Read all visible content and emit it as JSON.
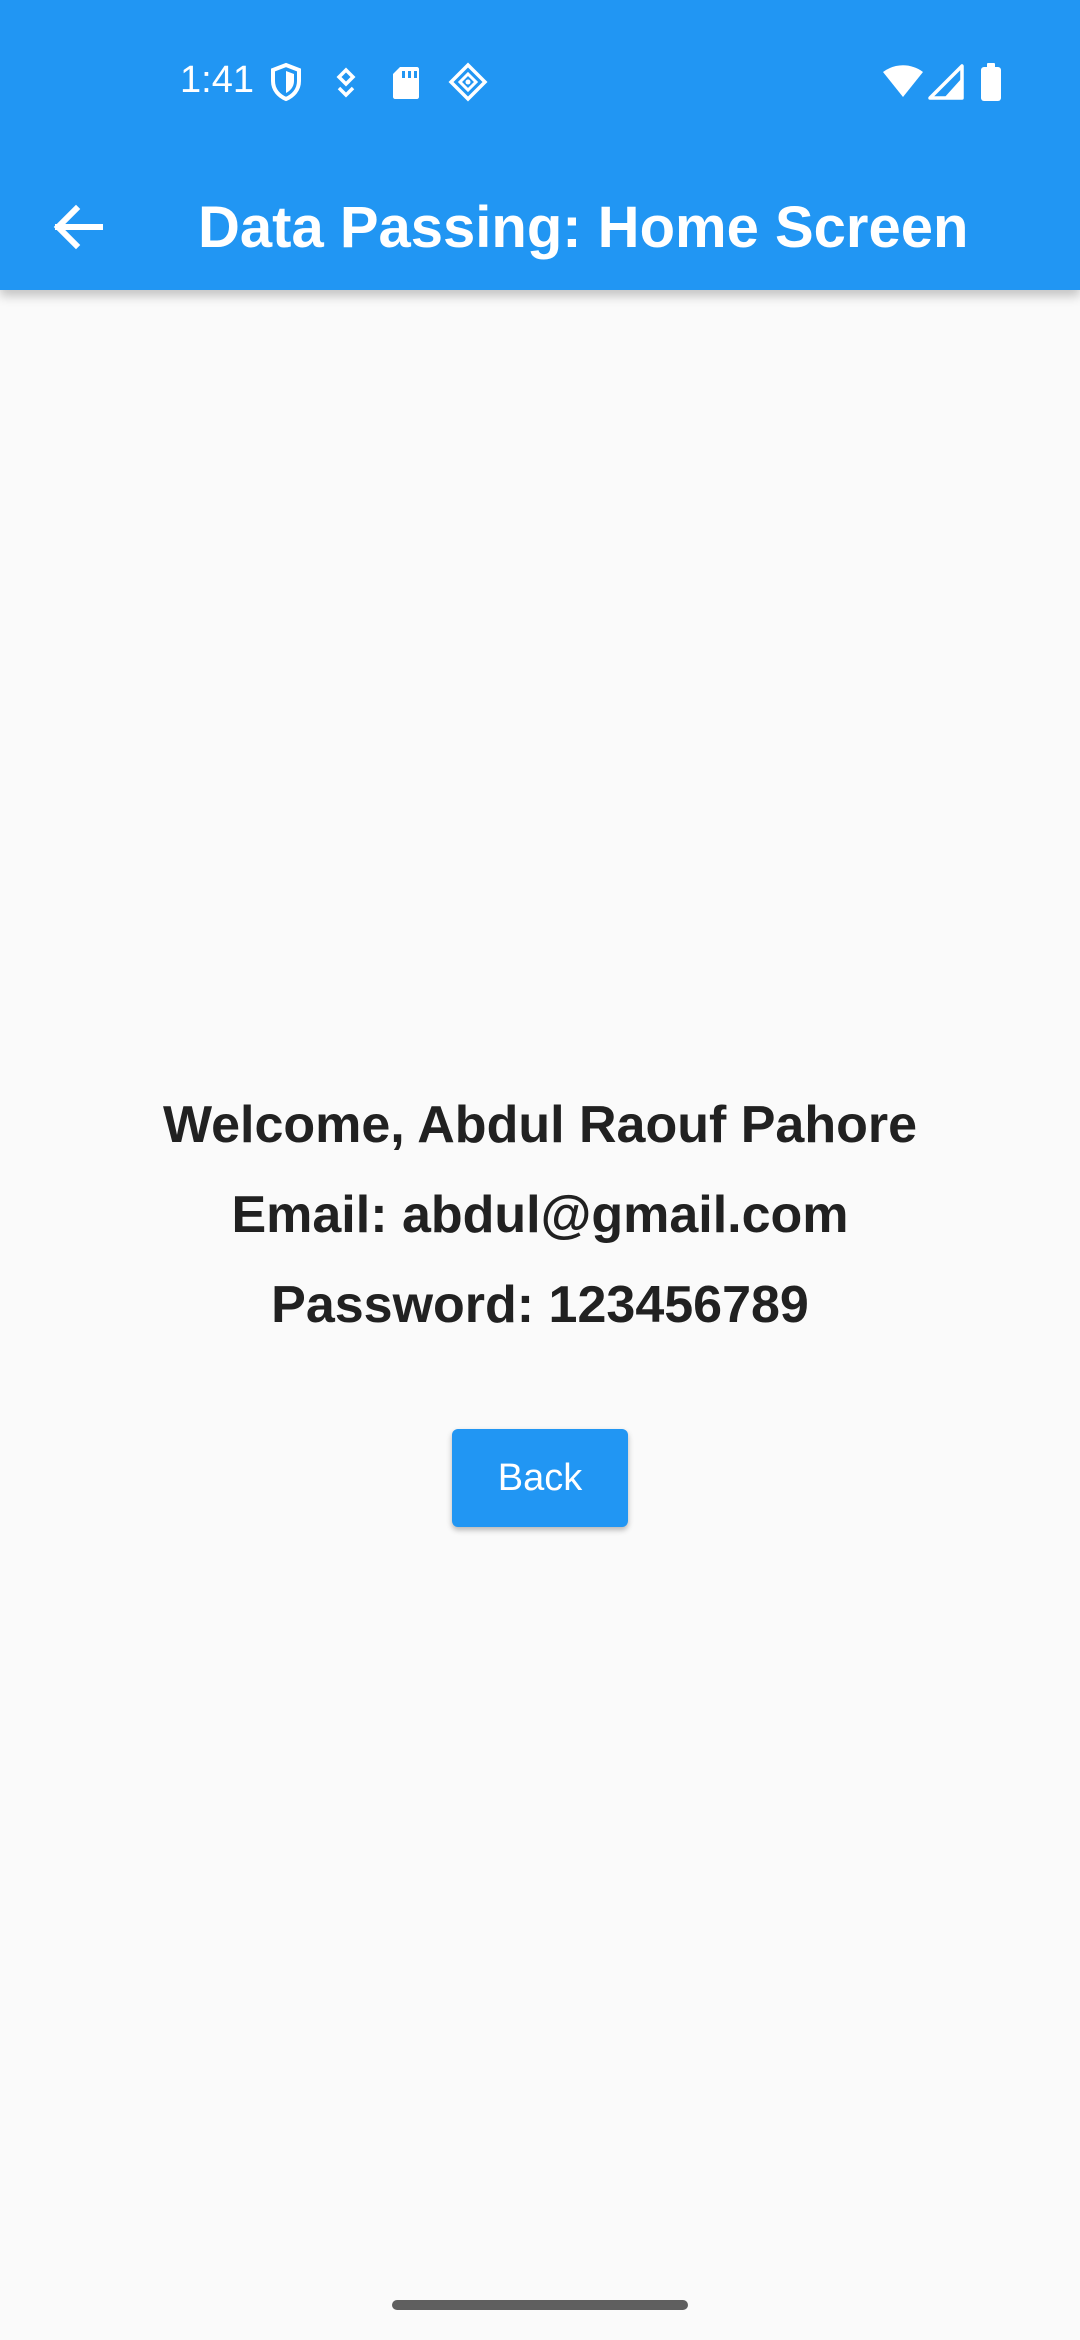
{
  "status_bar": {
    "time": "1:41",
    "left_icons": [
      "shield-icon",
      "location-pin-icon",
      "sd-card-icon",
      "diamond-grid-icon"
    ],
    "right_icons": [
      "wifi-icon",
      "cellular-signal-icon",
      "battery-icon"
    ]
  },
  "app_bar": {
    "title": "Data Passing: Home Screen",
    "back_icon": "arrow-back-icon",
    "background_color": "#2196f3"
  },
  "content": {
    "welcome_text": "Welcome, Abdul Raouf Pahore",
    "email_text": "Email: abdul@gmail.com",
    "password_text": "Password: 123456789"
  },
  "actions": {
    "back_label": "Back",
    "button_color": "#2196f3"
  }
}
